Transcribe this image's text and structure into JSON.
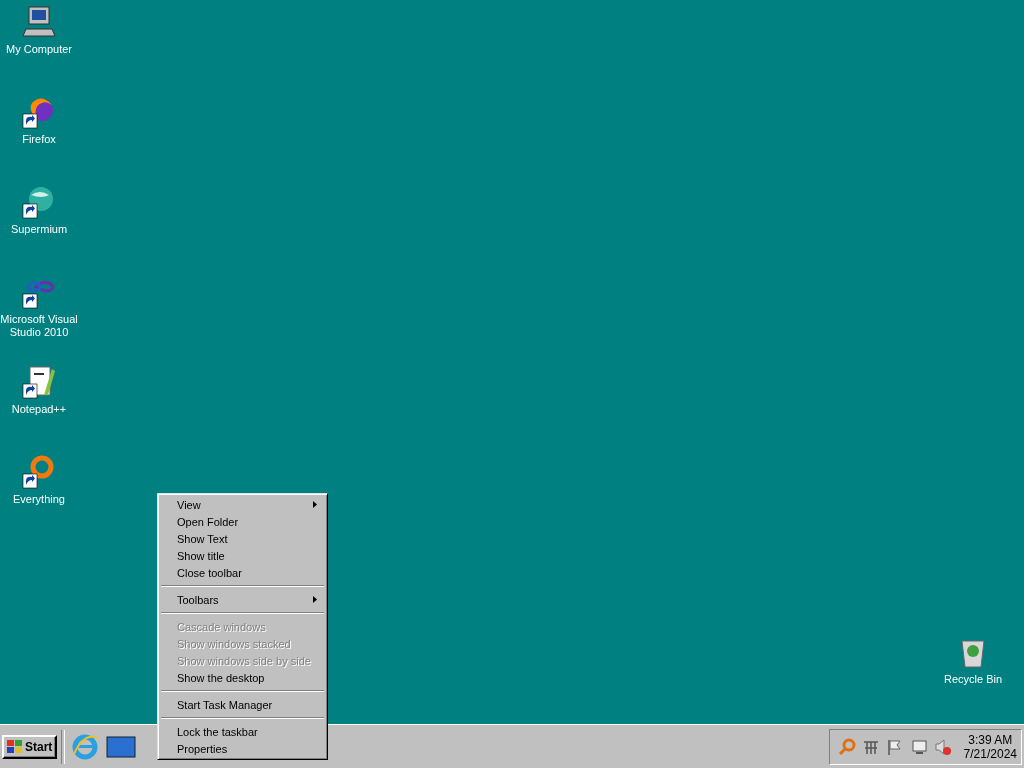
{
  "desktop_icons": [
    {
      "label": "My Computer",
      "shortcut": false,
      "kind": "computer"
    },
    {
      "label": "Firefox",
      "shortcut": true,
      "kind": "browser"
    },
    {
      "label": "Supermium",
      "shortcut": true,
      "kind": "globe"
    },
    {
      "label": "Microsoft Visual Studio 2010",
      "shortcut": true,
      "kind": "infinity"
    },
    {
      "label": "Notepad++",
      "shortcut": true,
      "kind": "notepad"
    },
    {
      "label": "Everything",
      "shortcut": true,
      "kind": "magnifier"
    }
  ],
  "recycle_bin": {
    "label": "Recycle Bin"
  },
  "context_menu": [
    {
      "kind": "item",
      "label": "View",
      "submenu": true,
      "disabled": false
    },
    {
      "kind": "item",
      "label": "Open Folder",
      "submenu": false,
      "disabled": false
    },
    {
      "kind": "item",
      "label": "Show Text",
      "submenu": false,
      "disabled": false
    },
    {
      "kind": "item",
      "label": "Show title",
      "submenu": false,
      "disabled": false
    },
    {
      "kind": "item",
      "label": "Close toolbar",
      "submenu": false,
      "disabled": false
    },
    {
      "kind": "separator"
    },
    {
      "kind": "item",
      "label": "Toolbars",
      "submenu": true,
      "disabled": false
    },
    {
      "kind": "separator"
    },
    {
      "kind": "item",
      "label": "Cascade windows",
      "submenu": false,
      "disabled": true
    },
    {
      "kind": "item",
      "label": "Show windows stacked",
      "submenu": false,
      "disabled": true
    },
    {
      "kind": "item",
      "label": "Show windows side by side",
      "submenu": false,
      "disabled": true
    },
    {
      "kind": "item",
      "label": "Show the desktop",
      "submenu": false,
      "disabled": false
    },
    {
      "kind": "separator"
    },
    {
      "kind": "item",
      "label": "Start Task Manager",
      "submenu": false,
      "disabled": false
    },
    {
      "kind": "separator"
    },
    {
      "kind": "item",
      "label": "Lock the taskbar",
      "submenu": false,
      "disabled": false
    },
    {
      "kind": "item",
      "label": "Properties",
      "submenu": false,
      "disabled": false
    }
  ],
  "taskbar": {
    "start_label": "Start",
    "clock": {
      "time": "3:39 AM",
      "date": "7/21/2024"
    }
  }
}
